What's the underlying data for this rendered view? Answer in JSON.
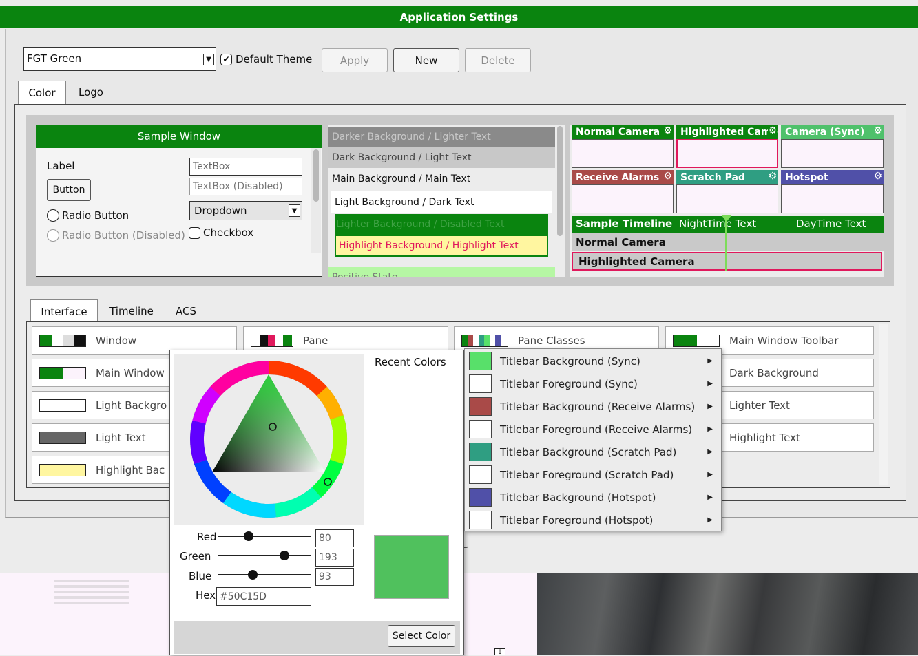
{
  "window": {
    "title": "Application Settings"
  },
  "theme_bar": {
    "selected_theme": "FGT Green",
    "default_theme_label": "Default Theme",
    "apply_label": "Apply",
    "new_label": "New",
    "delete_label": "Delete"
  },
  "top_tabs": [
    {
      "label": "Color"
    },
    {
      "label": "Logo"
    }
  ],
  "sample_window": {
    "title": "Sample Window",
    "label": "Label",
    "button": "Button",
    "radio": "Radio Button",
    "radio_disabled": "Radio Button (Disabled)",
    "textbox": "TextBox",
    "textbox_disabled": "TextBox (Disabled)",
    "dropdown": "Dropdown",
    "checkbox": "Checkbox"
  },
  "swatch_list": [
    "Darker Background / Lighter Text",
    "Dark Background / Light Text",
    "Main Background / Main Text",
    "Light Background / Dark Text",
    "Lighter Background / Disabled Text",
    "Highlight Background / Highlight Text",
    "Positive State"
  ],
  "cameras": [
    {
      "title": "Normal Camera",
      "color": "#0a840f"
    },
    {
      "title": "Highlighted Camera",
      "color": "#0a840f"
    },
    {
      "title": "Camera (Sync)",
      "color": "#4fc16b"
    },
    {
      "title": "Receive Alarms",
      "color": "#a94a48"
    },
    {
      "title": "Scratch Pad",
      "color": "#2f9e82"
    },
    {
      "title": "Hotspot",
      "color": "#5050a8"
    }
  ],
  "timeline": {
    "title": "Sample Timeline",
    "night": "NightTime Text",
    "day": "DayTime Text",
    "normal": "Normal Camera",
    "highlighted": "Highlighted Camera"
  },
  "bottom_tabs": [
    {
      "label": "Interface"
    },
    {
      "label": "Timeline"
    },
    {
      "label": "ACS"
    }
  ],
  "interface_items": {
    "window": "Window",
    "pane": "Pane",
    "pane_classes": "Pane Classes",
    "main_window_toolbar": "Main Window Toolbar",
    "main_window": "Main Window",
    "dark_background": "Dark Background",
    "light_background": "Light Backgro",
    "lighter_text": "Lighter Text",
    "light_text": "Light Text",
    "highlight_text": "Highlight Text",
    "highlight_background": "Highlight Bac"
  },
  "color_picker": {
    "recent_colors_label": "Recent Colors",
    "red_label": "Red",
    "red_value": "80",
    "green_label": "Green",
    "green_value": "193",
    "blue_label": "Blue",
    "blue_value": "93",
    "hex_label": "Hex",
    "hex_value": "#50C15D",
    "select_label": "Select Color",
    "preview_color": "#50c15d"
  },
  "context_menu": [
    {
      "label": "Titlebar Background (Sync)",
      "color": "#58e06a"
    },
    {
      "label": "Titlebar Foreground (Sync)",
      "color": "#ffffff"
    },
    {
      "label": "Titlebar Background (Receive Alarms)",
      "color": "#a94a48"
    },
    {
      "label": "Titlebar Foreground (Receive Alarms)",
      "color": "#ffffff"
    },
    {
      "label": "Titlebar Background (Scratch Pad)",
      "color": "#2f9e82"
    },
    {
      "label": "Titlebar Foreground (Scratch Pad)",
      "color": "#ffffff"
    },
    {
      "label": "Titlebar Background (Hotspot)",
      "color": "#5050a8"
    },
    {
      "label": "Titlebar Foreground (Hotspot)",
      "color": "#ffffff"
    }
  ],
  "colors": {
    "brand_green": "#0a840f",
    "highlight_red": "#e0185c"
  }
}
